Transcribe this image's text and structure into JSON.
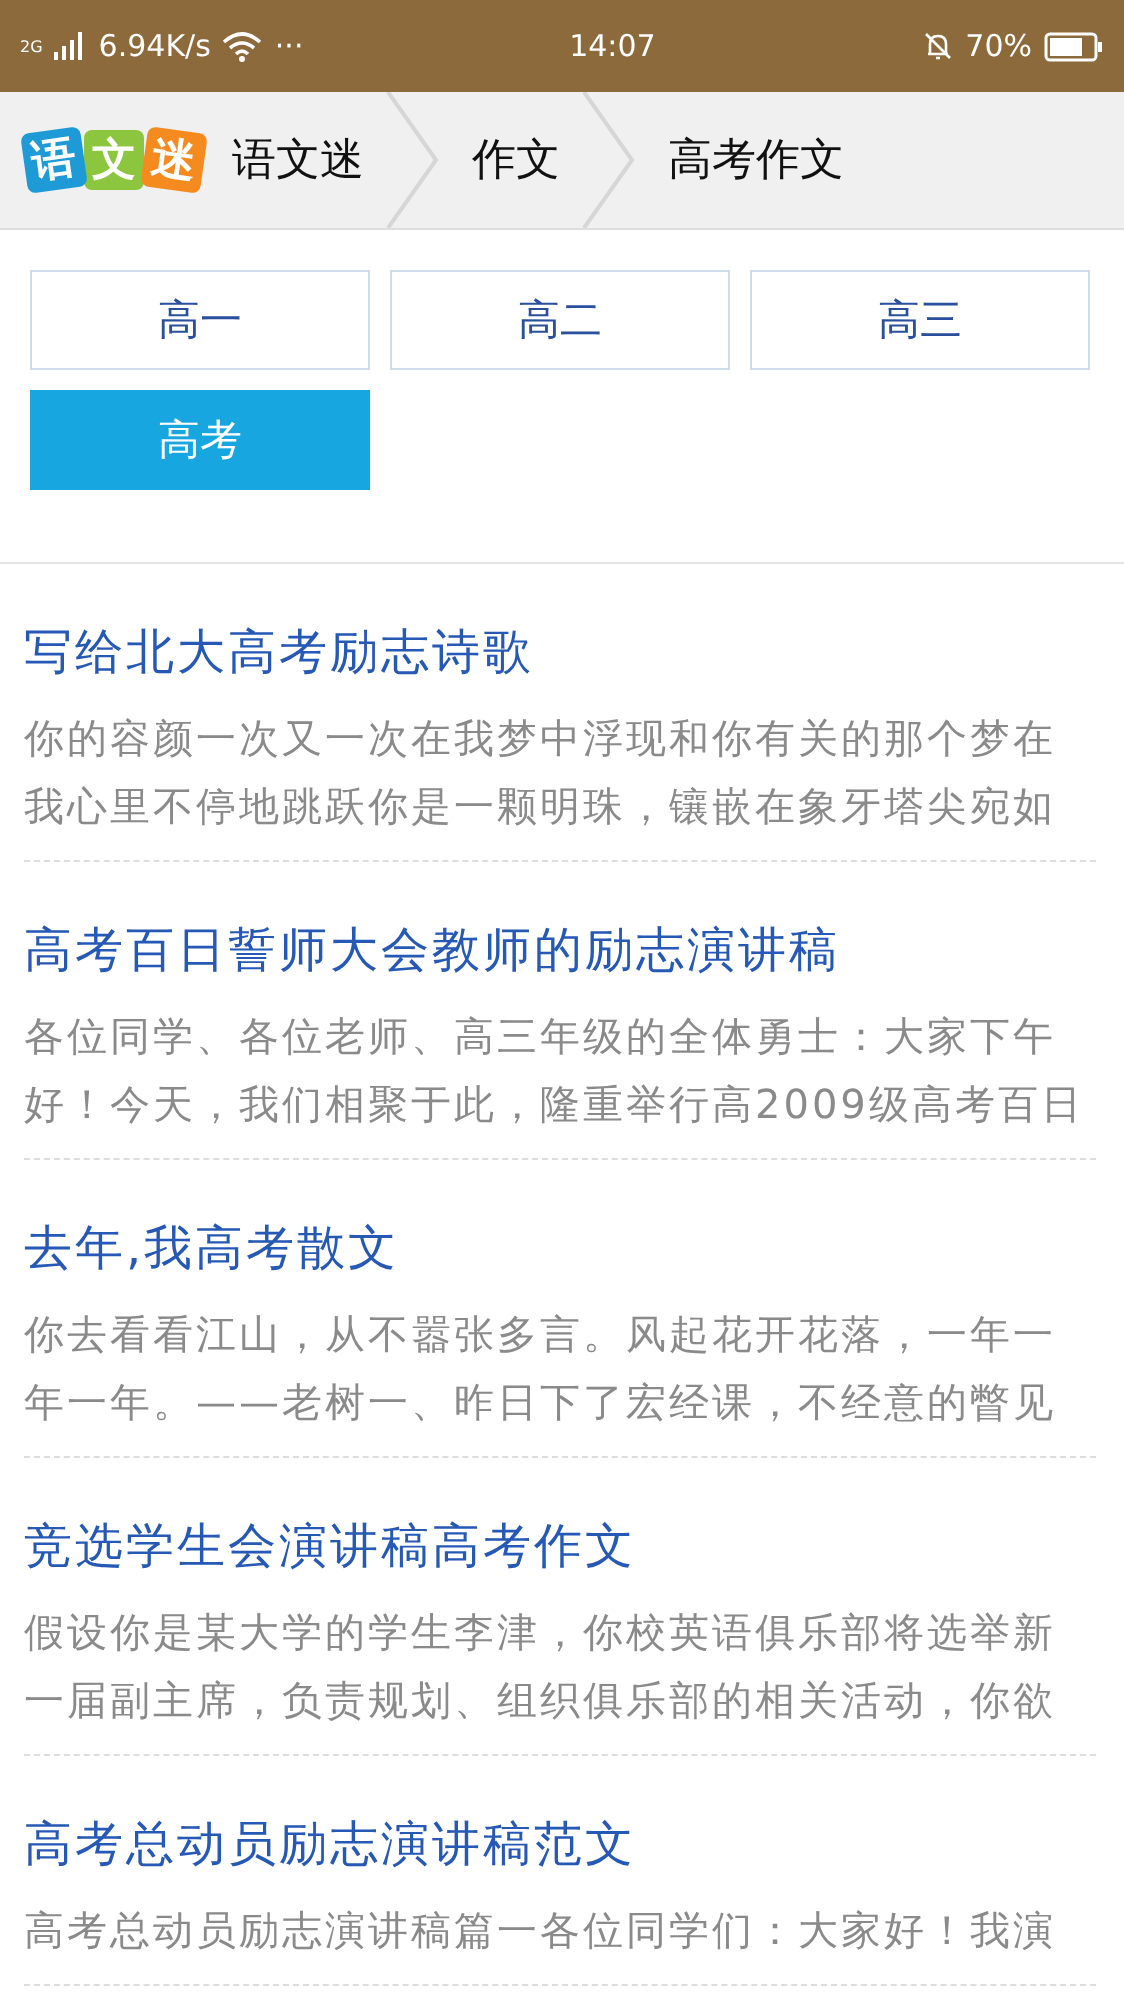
{
  "status_bar": {
    "network": "2G",
    "speed": "6.94K/s",
    "more": "···",
    "time": "14:07",
    "battery": "70%"
  },
  "header": {
    "logo": [
      {
        "char": "语",
        "color": "#1e9ad6"
      },
      {
        "char": "文",
        "color": "#8cc63f"
      },
      {
        "char": "迷",
        "color": "#f58a1f"
      }
    ],
    "breadcrumbs": [
      "语文迷",
      "作文",
      "高考作文"
    ]
  },
  "grades": [
    {
      "label": "高一",
      "selected": false
    },
    {
      "label": "高二",
      "selected": false
    },
    {
      "label": "高三",
      "selected": false
    },
    {
      "label": "高考",
      "selected": true
    }
  ],
  "articles": [
    {
      "title": "写给北大高考励志诗歌",
      "lines": [
        "你的容颜一次又一次在我梦中浮现和你有关的那个梦在",
        "我心里不停地跳跃你是一颗明珠，镶嵌在象牙塔尖宛如"
      ]
    },
    {
      "title": "高考百日誓师大会教师的励志演讲稿",
      "lines": [
        "各位同学、各位老师、高三年级的全体勇士：大家下午",
        "好！今天，我们相聚于此，隆重举行高2009级高考百日"
      ]
    },
    {
      "title": "去年,我高考散文",
      "lines": [
        "你去看看江山，从不嚣张多言。风起花开花落，一年一",
        "年一年。——老树一、昨日下了宏经课，不经意的瞥见"
      ]
    },
    {
      "title": "竞选学生会演讲稿高考作文",
      "lines": [
        "假设你是某大学的学生李津，你校英语俱乐部将选举新",
        "一届副主席，负责规划、组织俱乐部的相关活动，你欲"
      ]
    },
    {
      "title": "高考总动员励志演讲稿范文",
      "lines": [
        "高考总动员励志演讲稿篇一各位同学们：大家好！我演"
      ]
    }
  ]
}
